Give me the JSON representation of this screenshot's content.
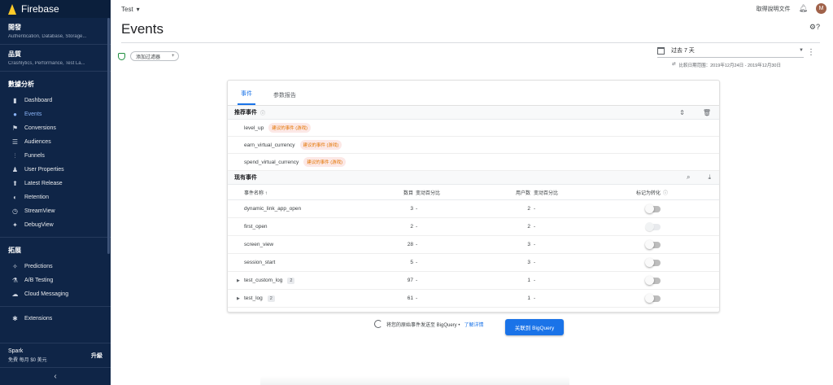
{
  "sidebar": {
    "brand": "Firebase",
    "groups": [
      {
        "title": "開發",
        "subtitle": "Authentication, Database, Storage..."
      },
      {
        "title": "品質",
        "subtitle": "Crashlytics, Performance, Test La..."
      }
    ],
    "analytics_title": "數據分析",
    "analytics_items": [
      {
        "label": "Dashboard",
        "icon": "bar-chart-icon"
      },
      {
        "label": "Events",
        "icon": "events-icon",
        "active": true
      },
      {
        "label": "Conversions",
        "icon": "flag-icon"
      },
      {
        "label": "Audiences",
        "icon": "audiences-icon"
      },
      {
        "label": "Funnels",
        "icon": "funnel-icon"
      },
      {
        "label": "User Properties",
        "icon": "user-properties-icon"
      },
      {
        "label": "Latest Release",
        "icon": "release-icon"
      },
      {
        "label": "Retention",
        "icon": "retention-icon"
      },
      {
        "label": "StreamView",
        "icon": "clock-icon"
      },
      {
        "label": "DebugView",
        "icon": "debug-icon"
      }
    ],
    "grow_title": "拓展",
    "grow_items": [
      {
        "label": "Predictions",
        "icon": "magic-wand-icon"
      },
      {
        "label": "A/B Testing",
        "icon": "flask-icon"
      },
      {
        "label": "Cloud Messaging",
        "icon": "cloud-icon"
      }
    ],
    "extensions": "Extensions",
    "plan_name": "Spark",
    "plan_price": "免費 每月 $0 美元",
    "upgrade": "升級",
    "collapse_glyph": "‹"
  },
  "header": {
    "project": "Test",
    "docs_link": "取得說明文件",
    "avatar_initial": "M",
    "page_title": "Events",
    "title_icons": "⚙?"
  },
  "filters": {
    "add_filter": "添加过滤器",
    "date_range": "过去 7 天",
    "compare_text": "比較日期范围：2019年12月24日 - 2019年12月30日"
  },
  "tabs": [
    "事件",
    "参数报告"
  ],
  "suggested": {
    "title": "推荐事件",
    "events": [
      {
        "name": "level_up",
        "badge": "建议的事件 (游戏)"
      },
      {
        "name": "earn_virtual_currency",
        "badge": "建议的事件 (游戏)"
      },
      {
        "name": "spend_virtual_currency",
        "badge": "建议的事件 (游戏)"
      }
    ]
  },
  "existing": {
    "title": "现有事件",
    "columns": {
      "name": "事件名称 ↑",
      "count": "数目",
      "change1": "变动百分比",
      "users": "用户数",
      "change2": "变动百分比",
      "conversion": "标记为转化"
    },
    "rows": [
      {
        "name": "dynamic_link_app_open",
        "params": null,
        "count": "3",
        "change1": "-",
        "users": "2",
        "change2": "-",
        "conversion": false,
        "disabled": false
      },
      {
        "name": "first_open",
        "params": null,
        "count": "2",
        "change1": "-",
        "users": "2",
        "change2": "-",
        "conversion": true,
        "disabled": true
      },
      {
        "name": "screen_view",
        "params": null,
        "count": "28",
        "change1": "-",
        "users": "3",
        "change2": "-",
        "conversion": false,
        "disabled": false
      },
      {
        "name": "session_start",
        "params": null,
        "count": "5",
        "change1": "-",
        "users": "3",
        "change2": "-",
        "conversion": false,
        "disabled": false
      },
      {
        "name": "test_custom_log",
        "params": "2",
        "count": "97",
        "change1": "-",
        "users": "1",
        "change2": "-",
        "conversion": false,
        "disabled": false
      },
      {
        "name": "test_log",
        "params": "2",
        "count": "61",
        "change1": "-",
        "users": "1",
        "change2": "-",
        "conversion": false,
        "disabled": false
      }
    ]
  },
  "bigquery": {
    "text": "将您的原始事件发送至 BigQuery •",
    "link": "了解详情",
    "button": "关联到 BigQuery"
  }
}
